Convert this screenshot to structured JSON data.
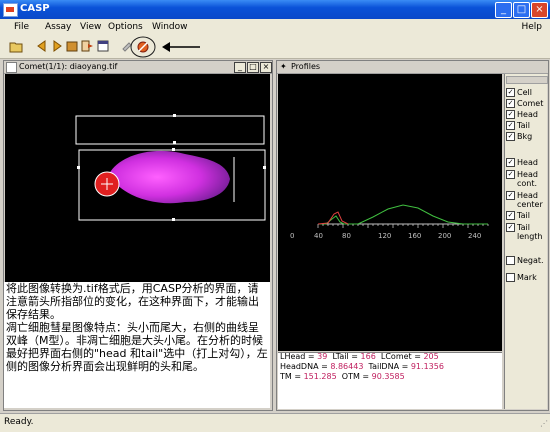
{
  "app": {
    "title": "CASP"
  },
  "window_controls": {
    "minimize": "_",
    "maximize": "□",
    "close": "×"
  },
  "menu": [
    "File",
    "Assay",
    "View",
    "Options",
    "Window"
  ],
  "help_label": "Help",
  "comet_window": {
    "title": "Comet(1/1): diaoyang.tif",
    "note": "将此图像转换为.tif格式后，用CASP分析的界面，请注意箭头所指部位的变化，在这种界面下，才能输出保存结果。\n凋亡细胞彗星图像特点：头小而尾大，右侧的曲线呈双峰（M型）。非凋亡细胞是大头小尾。在分析的时候最好把界面右侧的\"head 和tail\"选中（打上对勾），左侧的图像分析界面会出现鲜明的头和尾。"
  },
  "profiles_window": {
    "title": "Profiles",
    "x_ticks": [
      "0",
      "40",
      "80",
      "120",
      "160",
      "200",
      "240"
    ],
    "checks": [
      {
        "label": "Cell",
        "checked": true
      },
      {
        "label": "Comet",
        "checked": true
      },
      {
        "label": "Head",
        "checked": true
      },
      {
        "label": "Tail",
        "checked": true
      },
      {
        "label": "Bkg",
        "checked": true
      },
      {
        "label": "Head",
        "checked": true
      },
      {
        "label": "Head cont.",
        "checked": true
      },
      {
        "label": "Head center",
        "checked": true
      },
      {
        "label": "Tail",
        "checked": true
      },
      {
        "label": "Tail length",
        "checked": true
      },
      {
        "label": "Negat.",
        "checked": false
      },
      {
        "label": "Mark",
        "checked": false
      }
    ],
    "stats": [
      [
        [
          "LHead = ",
          "39"
        ],
        [
          "LTail = ",
          "166"
        ],
        [
          "LComet = ",
          "205"
        ]
      ],
      [
        [
          "HeadDNA = ",
          "8.86443"
        ],
        [
          "TailDNA = ",
          "91.1356"
        ]
      ],
      [
        [
          "TM = ",
          "151.285"
        ],
        [
          "OTM = ",
          "90.3585"
        ]
      ]
    ]
  },
  "status": "Ready.",
  "colors": {
    "titlebar": "#0a52d8",
    "comet": "#e040e0",
    "head_marker": "#e02020",
    "profile_green": "#40c040",
    "profile_red": "#e04040"
  }
}
